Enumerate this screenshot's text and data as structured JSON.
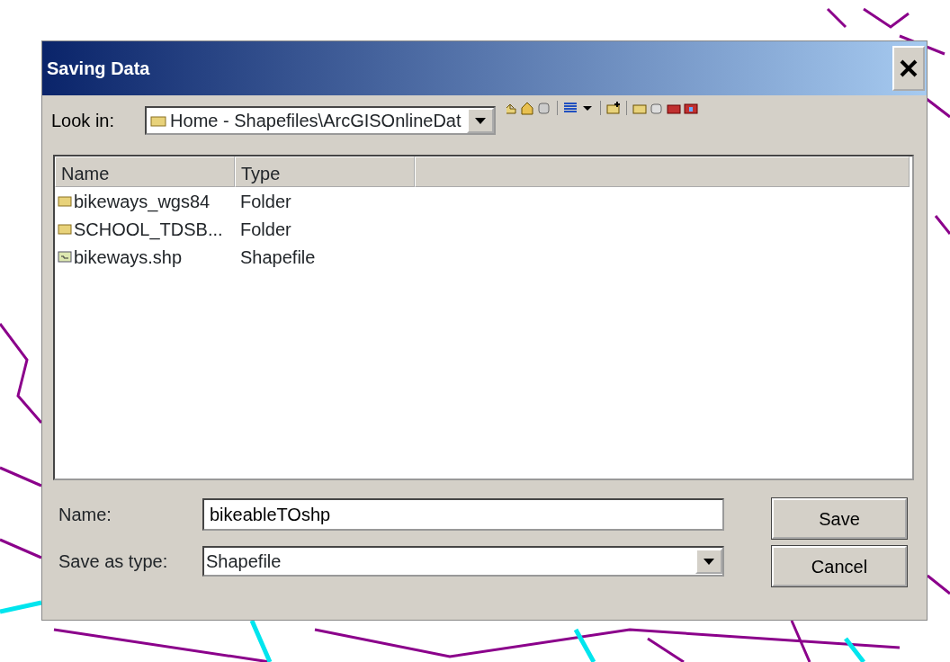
{
  "window": {
    "title": "Saving Data"
  },
  "look_in": {
    "label": "Look in:",
    "value": "Home - Shapefiles\\ArcGISOnlineDat"
  },
  "file_list": {
    "columns": [
      "Name",
      "Type"
    ],
    "rows": [
      {
        "name": "bikeways_wgs84",
        "type": "Folder",
        "kind": "folder"
      },
      {
        "name": "SCHOOL_TDSB...",
        "type": "Folder",
        "kind": "folder"
      },
      {
        "name": "bikeways.shp",
        "type": "Shapefile",
        "kind": "shapefile"
      }
    ]
  },
  "name_field": {
    "label": "Name:",
    "value": "bikeableTOshp"
  },
  "type_field": {
    "label": "Save as type:",
    "value": "Shapefile"
  },
  "buttons": [
    "Save",
    "Cancel"
  ]
}
